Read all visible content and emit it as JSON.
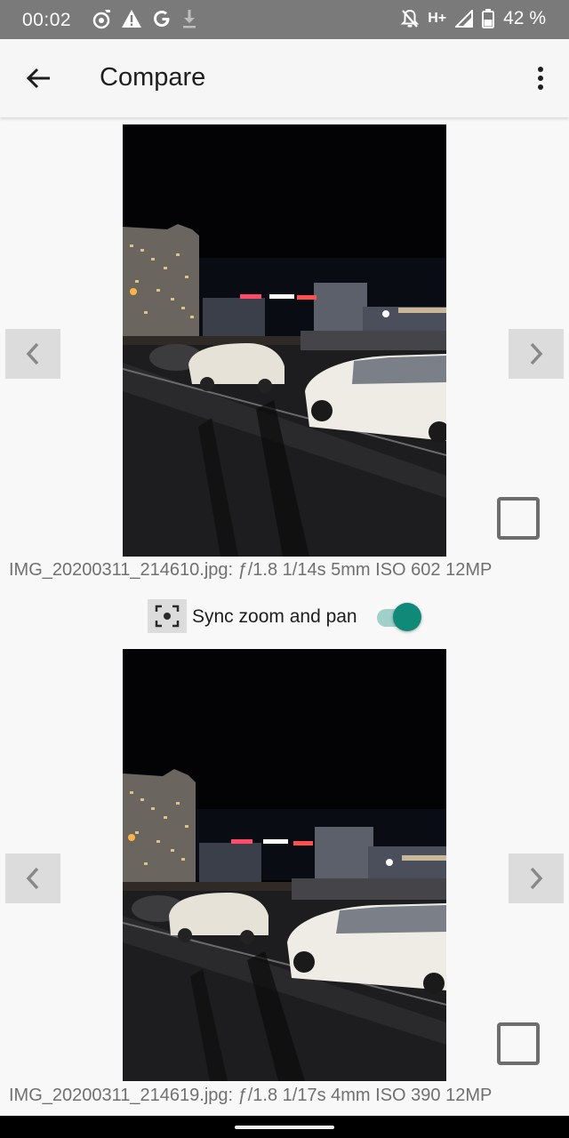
{
  "status_bar": {
    "time": "00:02",
    "network": "H+",
    "battery": "42 %",
    "icons": [
      "music-note-icon",
      "warning-icon",
      "google-icon",
      "download-icon",
      "mute-icon",
      "signal-icon",
      "battery-icon"
    ]
  },
  "app_bar": {
    "title": "Compare",
    "back_icon": "arrow-back-icon",
    "menu_icon": "more-vert-icon"
  },
  "photos": [
    {
      "caption": "IMG_20200311_214610.jpg: ƒ/1.8 1/14s 5mm ISO 602 12MP",
      "selected": false
    },
    {
      "caption": "IMG_20200311_214619.jpg: ƒ/1.8 1/17s 4mm ISO 390 12MP",
      "selected": false
    }
  ],
  "sync": {
    "label": "Sync zoom and pan",
    "enabled": true,
    "icon": "focus-frame-icon"
  },
  "colors": {
    "accent": "#0f8a79",
    "accent_track": "#9fd0c9",
    "status_bar": "#7a7a7a",
    "background": "#f8f8f8"
  }
}
